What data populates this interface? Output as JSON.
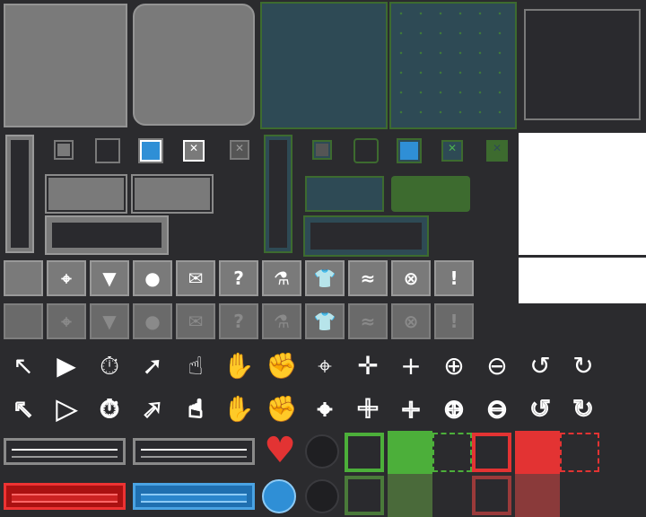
{
  "sheet": {
    "colors": {
      "background": "#2b2b2e",
      "panel_gray": "#7a7a7a",
      "panel_teal": "#2e4a55",
      "accent_green": "#3d6b2f",
      "accent_blue": "#2f8fd6",
      "accent_red": "#e33333"
    }
  },
  "slots": {
    "icons": [
      "",
      "crosshair-icon",
      "chest-armor-icon",
      "gear-icon",
      "bag-icon",
      "question-icon",
      "potion-icon",
      "shirt-icon",
      "wave-icon",
      "cancel-icon",
      "alert-icon"
    ],
    "glyphs": [
      "",
      "⌖",
      "▼",
      "●",
      "✉",
      "?",
      "⚗",
      "👕",
      "≈",
      "⊗",
      "!"
    ]
  },
  "cursors": {
    "icons": [
      "arrow-icon",
      "pointer-icon",
      "stopwatch-icon",
      "arrow-select-icon",
      "hand-point-icon",
      "hand-open-icon",
      "hand-grab-icon",
      "target-icon",
      "crosshair-thin-icon",
      "plus-icon",
      "zoom-in-icon",
      "zoom-out-icon",
      "rotate-left-icon",
      "rotate-right-icon"
    ],
    "glyphs": [
      "↖",
      "▶",
      "⏱",
      "➚",
      "☝",
      "✋",
      "✊",
      "⌖",
      "✛",
      "+",
      "⊕",
      "⊖",
      "↺",
      "↻"
    ]
  },
  "hud": {
    "heart_glyph": "♥",
    "plus_glyph": "+"
  }
}
